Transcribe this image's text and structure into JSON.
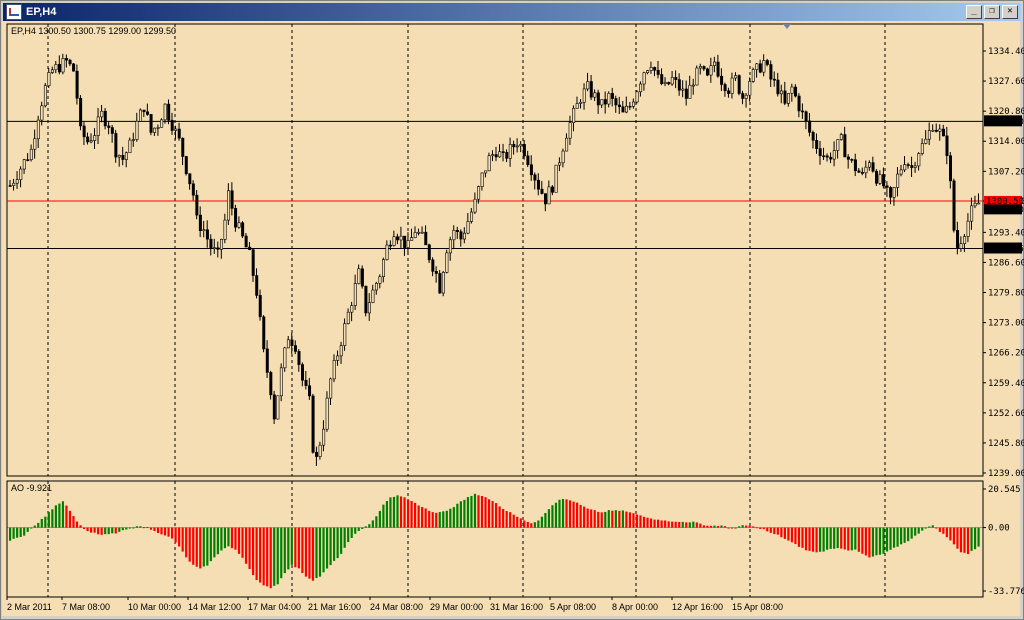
{
  "window": {
    "title": "EP,H4",
    "buttons": {
      "minimize": "_",
      "restore": "❐",
      "close": "✕"
    }
  },
  "colors": {
    "background": "#f5deb3",
    "bull_candle": "#f5deb3",
    "bear_candle": "#000000",
    "ao_up": "#008000",
    "ao_down": "#ff0000",
    "hline": "#000000",
    "bid_line": "#ff0000"
  },
  "chart_data": [
    {
      "type": "candlestick",
      "title": "EP,H4  1300.50 1300.75 1299.00 1299.50",
      "ylim": [
        1239.0,
        1334.4
      ],
      "y_ticks": [
        "1334.40",
        "1327.60",
        "1320.80",
        "1314.00",
        "1307.20",
        "1300.50",
        "1293.40",
        "1286.60",
        "1279.80",
        "1273.00",
        "1266.20",
        "1259.40",
        "1252.60",
        "1245.80",
        "1239.00"
      ],
      "horizontal_lines": [
        {
          "label": "1318.50",
          "value": 1318.5
        },
        {
          "label": "1289.75",
          "value": 1289.75
        }
      ],
      "bid_line": {
        "label": "1300.50",
        "value": 1300.5
      },
      "last_price": {
        "label": "1299.50",
        "value": 1299.5
      },
      "x_ticks": [
        "2 Mar 2011",
        "7 Mar 08:00",
        "10 Mar 00:00",
        "14 Mar 12:00",
        "17 Mar 04:00",
        "21 Mar 16:00",
        "24 Mar 08:00",
        "29 Mar 00:00",
        "31 Mar 16:00",
        "5 Apr 08:00",
        "8 Apr 00:00",
        "12 Apr 16:00",
        "15 Apr 08:00"
      ],
      "close_path": [
        [
          0,
          1304
        ],
        [
          3,
          1308
        ],
        [
          6,
          1312
        ],
        [
          8,
          1320
        ],
        [
          10,
          1326
        ],
        [
          12,
          1330
        ],
        [
          14,
          1331
        ],
        [
          16,
          1332
        ],
        [
          18,
          1330
        ],
        [
          19,
          1324
        ],
        [
          20,
          1316
        ],
        [
          22,
          1314
        ],
        [
          24,
          1316
        ],
        [
          26,
          1320
        ],
        [
          28,
          1318
        ],
        [
          30,
          1312
        ],
        [
          32,
          1310
        ],
        [
          34,
          1313
        ],
        [
          36,
          1318
        ],
        [
          38,
          1322
        ],
        [
          40,
          1316
        ],
        [
          42,
          1318
        ],
        [
          44,
          1322
        ],
        [
          46,
          1318
        ],
        [
          48,
          1314
        ],
        [
          50,
          1308
        ],
        [
          52,
          1302
        ],
        [
          53,
          1296
        ],
        [
          55,
          1294
        ],
        [
          57,
          1290
        ],
        [
          59,
          1288
        ],
        [
          61,
          1296
        ],
        [
          62,
          1302
        ],
        [
          64,
          1296
        ],
        [
          66,
          1292
        ],
        [
          68,
          1288
        ],
        [
          70,
          1280
        ],
        [
          72,
          1266
        ],
        [
          74,
          1258
        ],
        [
          75,
          1252
        ],
        [
          77,
          1262
        ],
        [
          79,
          1270
        ],
        [
          81,
          1268
        ],
        [
          83,
          1260
        ],
        [
          85,
          1255
        ],
        [
          86,
          1245
        ],
        [
          87,
          1242
        ],
        [
          89,
          1250
        ],
        [
          91,
          1260
        ],
        [
          93,
          1266
        ],
        [
          95,
          1272
        ],
        [
          97,
          1278
        ],
        [
          99,
          1284
        ],
        [
          101,
          1276
        ],
        [
          103,
          1280
        ],
        [
          105,
          1284
        ],
        [
          107,
          1290
        ],
        [
          109,
          1294
        ],
        [
          111,
          1292
        ],
        [
          113,
          1290
        ],
        [
          115,
          1294
        ],
        [
          117,
          1292
        ],
        [
          119,
          1288
        ],
        [
          121,
          1284
        ],
        [
          122,
          1281
        ],
        [
          124,
          1290
        ],
        [
          126,
          1294
        ],
        [
          128,
          1292
        ],
        [
          130,
          1296
        ],
        [
          132,
          1300
        ],
        [
          134,
          1306
        ],
        [
          136,
          1310
        ],
        [
          138,
          1312
        ],
        [
          140,
          1310
        ],
        [
          142,
          1312
        ],
        [
          144,
          1314
        ],
        [
          146,
          1312
        ],
        [
          148,
          1308
        ],
        [
          150,
          1304
        ],
        [
          152,
          1301
        ],
        [
          154,
          1304
        ],
        [
          156,
          1310
        ],
        [
          158,
          1316
        ],
        [
          160,
          1320
        ],
        [
          162,
          1324
        ],
        [
          164,
          1326
        ],
        [
          166,
          1324
        ],
        [
          168,
          1322
        ],
        [
          170,
          1324
        ],
        [
          172,
          1322
        ],
        [
          174,
          1320
        ],
        [
          176,
          1322
        ],
        [
          178,
          1326
        ],
        [
          180,
          1330
        ],
        [
          182,
          1332
        ],
        [
          184,
          1328
        ],
        [
          186,
          1326
        ],
        [
          188,
          1328
        ],
        [
          190,
          1326
        ],
        [
          192,
          1324
        ],
        [
          194,
          1328
        ],
        [
          196,
          1330
        ],
        [
          198,
          1328
        ],
        [
          200,
          1332
        ],
        [
          202,
          1328
        ],
        [
          204,
          1326
        ],
        [
          206,
          1328
        ],
        [
          208,
          1324
        ],
        [
          210,
          1328
        ],
        [
          212,
          1330
        ],
        [
          214,
          1332
        ],
        [
          216,
          1328
        ],
        [
          218,
          1326
        ],
        [
          220,
          1322
        ],
        [
          222,
          1326
        ],
        [
          224,
          1322
        ],
        [
          226,
          1318
        ],
        [
          228,
          1314
        ],
        [
          230,
          1312
        ],
        [
          232,
          1310
        ],
        [
          234,
          1312
        ],
        [
          236,
          1314
        ],
        [
          238,
          1310
        ],
        [
          240,
          1308
        ],
        [
          242,
          1306
        ],
        [
          244,
          1310
        ],
        [
          246,
          1306
        ],
        [
          248,
          1304
        ],
        [
          250,
          1300
        ],
        [
          252,
          1306
        ],
        [
          254,
          1310
        ],
        [
          256,
          1308
        ],
        [
          258,
          1312
        ],
        [
          260,
          1314
        ],
        [
          262,
          1318
        ],
        [
          264,
          1316
        ],
        [
          266,
          1312
        ],
        [
          267,
          1304
        ],
        [
          268,
          1294
        ],
        [
          269,
          1290
        ],
        [
          271,
          1294
        ],
        [
          273,
          1298
        ],
        [
          275,
          1300
        ]
      ]
    },
    {
      "type": "bar",
      "title": "AO -9.921",
      "ylim": [
        -33.776,
        20.545
      ],
      "y_ticks": [
        "20.545",
        "0.00",
        "-33.776"
      ],
      "ao_path": [
        [
          0,
          -7
        ],
        [
          4,
          -4
        ],
        [
          7,
          1
        ],
        [
          10,
          6
        ],
        [
          13,
          12
        ],
        [
          15,
          14
        ],
        [
          16,
          12
        ],
        [
          18,
          6
        ],
        [
          20,
          1
        ],
        [
          22,
          -2
        ],
        [
          26,
          -4
        ],
        [
          30,
          -3
        ],
        [
          33,
          -1
        ],
        [
          35,
          0
        ],
        [
          37,
          1
        ],
        [
          39,
          0
        ],
        [
          41,
          -2
        ],
        [
          44,
          -4
        ],
        [
          46,
          -6
        ],
        [
          48,
          -10
        ],
        [
          50,
          -16
        ],
        [
          52,
          -20
        ],
        [
          54,
          -22
        ],
        [
          56,
          -20
        ],
        [
          58,
          -16
        ],
        [
          60,
          -12
        ],
        [
          62,
          -10
        ],
        [
          64,
          -12
        ],
        [
          66,
          -16
        ],
        [
          68,
          -22
        ],
        [
          70,
          -28
        ],
        [
          72,
          -31
        ],
        [
          74,
          -32
        ],
        [
          76,
          -30
        ],
        [
          78,
          -24
        ],
        [
          80,
          -20
        ],
        [
          82,
          -22
        ],
        [
          84,
          -26
        ],
        [
          86,
          -28
        ],
        [
          88,
          -26
        ],
        [
          90,
          -22
        ],
        [
          92,
          -18
        ],
        [
          94,
          -14
        ],
        [
          96,
          -8
        ],
        [
          98,
          -3
        ],
        [
          100,
          -1
        ],
        [
          102,
          2
        ],
        [
          104,
          6
        ],
        [
          106,
          12
        ],
        [
          108,
          16
        ],
        [
          110,
          17
        ],
        [
          112,
          16
        ],
        [
          114,
          14
        ],
        [
          116,
          12
        ],
        [
          118,
          10
        ],
        [
          120,
          8
        ],
        [
          122,
          8
        ],
        [
          124,
          9
        ],
        [
          126,
          11
        ],
        [
          128,
          14
        ],
        [
          130,
          16
        ],
        [
          132,
          18
        ],
        [
          134,
          17
        ],
        [
          136,
          15
        ],
        [
          138,
          13
        ],
        [
          140,
          10
        ],
        [
          142,
          8
        ],
        [
          144,
          6
        ],
        [
          146,
          4
        ],
        [
          148,
          2
        ],
        [
          150,
          4
        ],
        [
          152,
          8
        ],
        [
          154,
          12
        ],
        [
          156,
          15
        ],
        [
          158,
          15
        ],
        [
          160,
          14
        ],
        [
          162,
          12
        ],
        [
          164,
          10
        ],
        [
          166,
          9
        ],
        [
          168,
          8
        ],
        [
          170,
          9
        ],
        [
          172,
          9
        ],
        [
          174,
          9
        ],
        [
          176,
          8
        ],
        [
          178,
          7
        ],
        [
          180,
          6
        ],
        [
          182,
          5
        ],
        [
          184,
          4
        ],
        [
          186,
          4
        ],
        [
          188,
          3
        ],
        [
          190,
          3
        ],
        [
          192,
          3
        ],
        [
          194,
          3
        ],
        [
          196,
          2
        ],
        [
          198,
          1
        ],
        [
          200,
          1
        ],
        [
          202,
          1
        ],
        [
          204,
          0
        ],
        [
          206,
          0
        ],
        [
          208,
          1
        ],
        [
          210,
          1
        ],
        [
          212,
          0
        ],
        [
          214,
          -1
        ],
        [
          216,
          -3
        ],
        [
          218,
          -4
        ],
        [
          220,
          -6
        ],
        [
          222,
          -8
        ],
        [
          224,
          -10
        ],
        [
          226,
          -12
        ],
        [
          228,
          -13
        ],
        [
          230,
          -13
        ],
        [
          232,
          -12
        ],
        [
          234,
          -11
        ],
        [
          236,
          -11
        ],
        [
          238,
          -12
        ],
        [
          240,
          -12
        ],
        [
          242,
          -14
        ],
        [
          244,
          -16
        ],
        [
          246,
          -15
        ],
        [
          248,
          -14
        ],
        [
          250,
          -12
        ],
        [
          252,
          -10
        ],
        [
          254,
          -8
        ],
        [
          256,
          -6
        ],
        [
          258,
          -3
        ],
        [
          260,
          0
        ],
        [
          262,
          1
        ],
        [
          264,
          -2
        ],
        [
          266,
          -5
        ],
        [
          268,
          -9
        ],
        [
          270,
          -13
        ],
        [
          272,
          -14
        ],
        [
          275,
          -10
        ]
      ]
    }
  ]
}
